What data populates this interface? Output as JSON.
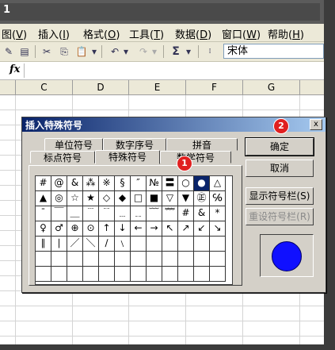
{
  "window": {
    "title": "1"
  },
  "menu": [
    {
      "label": "图(",
      "key": "V",
      "tail": ")"
    },
    {
      "label": "插入(",
      "key": "I",
      "tail": ")"
    },
    {
      "label": "格式(",
      "key": "O",
      "tail": ")"
    },
    {
      "label": "工具(",
      "key": "T",
      "tail": ")"
    },
    {
      "label": "数据(",
      "key": "D",
      "tail": ")"
    },
    {
      "label": "窗口(",
      "key": "W",
      "tail": ")"
    },
    {
      "label": "帮助(",
      "key": "H",
      "tail": ")"
    }
  ],
  "toolbar": {
    "sigma": "Σ",
    "font_name": "宋体"
  },
  "formula_bar": {
    "fx": "fx"
  },
  "columns": [
    "C",
    "D",
    "E",
    "F",
    "G"
  ],
  "dialog": {
    "title": "插入特殊符号",
    "close": "x",
    "tabs_back": [
      "单位符号",
      "数字序号",
      "拼音"
    ],
    "tabs_front": [
      "标点符号",
      "特殊符号",
      "数学符号"
    ],
    "active_tab": "特殊符号",
    "symbols": [
      [
        "#",
        "@",
        "&",
        "⁂",
        "※",
        "§",
        "″",
        "№",
        "〓",
        "○",
        "●",
        "△"
      ],
      [
        "▲",
        "◎",
        "☆",
        "★",
        "◇",
        "◆",
        "□",
        "■",
        "▽",
        "▼",
        "㊣",
        "℅"
      ],
      [
        "ˉ",
        "￣",
        "＿",
        "﹉",
        "﹊",
        "﹍",
        "﹎",
        "﹋",
        "﹌",
        "#",
        "&",
        "*"
      ],
      [
        "♀",
        "♂",
        "⊕",
        "⊙",
        "↑",
        "↓",
        "←",
        "→",
        "↖",
        "↗",
        "↙",
        "↘"
      ],
      [
        "∥",
        "∣",
        "／",
        "＼",
        "∕",
        "﹨",
        "",
        "",
        "",
        "",
        "",
        ""
      ],
      [
        "",
        "",
        "",
        "",
        "",
        "",
        "",
        "",
        "",
        "",
        "",
        ""
      ],
      [
        "",
        "",
        "",
        "",
        "",
        "",
        "",
        "",
        "",
        "",
        "",
        ""
      ]
    ],
    "selected_symbol": "●",
    "buttons": {
      "ok": "确定",
      "cancel": "取消",
      "show_bar": "显示符号栏(S)",
      "reset_bar": "重设符号栏(R)"
    },
    "preview_color": "#1010ff"
  },
  "annotations": {
    "one": "1",
    "two": "2"
  }
}
